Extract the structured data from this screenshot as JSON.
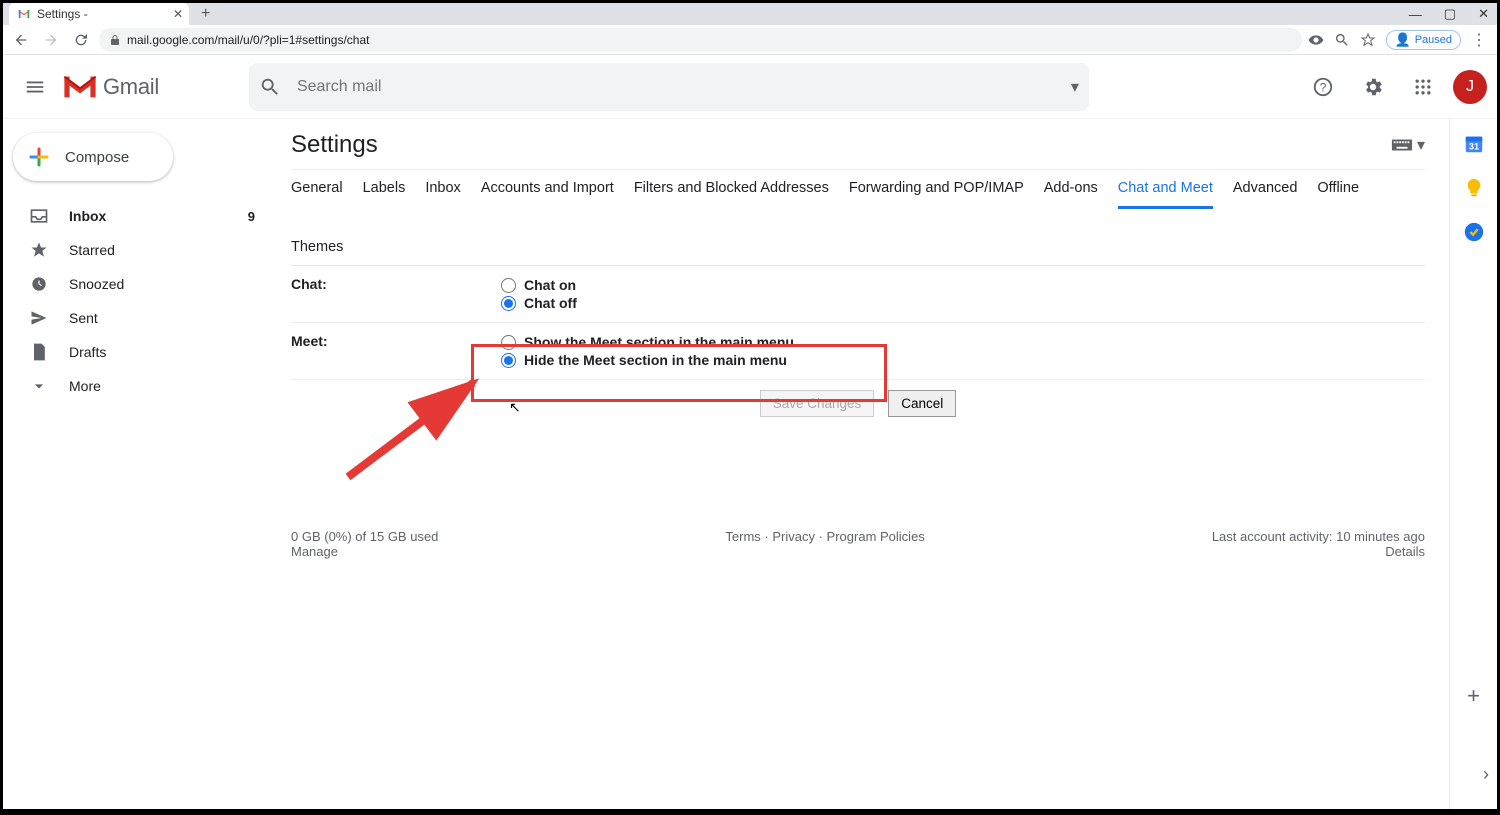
{
  "browser": {
    "tab_title": "Settings -",
    "url": "mail.google.com/mail/u/0/?pli=1#settings/chat",
    "paused_label": "Paused"
  },
  "header": {
    "app_name": "Gmail",
    "search_placeholder": "Search mail",
    "avatar_letter": "J"
  },
  "sidebar": {
    "compose_label": "Compose",
    "items": [
      {
        "label": "Inbox",
        "count": "9",
        "bold": true
      },
      {
        "label": "Starred"
      },
      {
        "label": "Snoozed"
      },
      {
        "label": "Sent"
      },
      {
        "label": "Drafts"
      },
      {
        "label": "More"
      }
    ]
  },
  "settings": {
    "title": "Settings",
    "tabs": [
      "General",
      "Labels",
      "Inbox",
      "Accounts and Import",
      "Filters and Blocked Addresses",
      "Forwarding and POP/IMAP",
      "Add-ons",
      "Chat and Meet",
      "Advanced",
      "Offline",
      "Themes"
    ],
    "active_tab": "Chat and Meet",
    "chat": {
      "label": "Chat:",
      "opt_on": "Chat on",
      "opt_off": "Chat off",
      "selected": "off"
    },
    "meet": {
      "label": "Meet:",
      "opt_show": "Show the Meet section in the main menu",
      "opt_hide": "Hide the Meet section in the main menu",
      "selected": "hide"
    },
    "save_label": "Save Changes",
    "cancel_label": "Cancel"
  },
  "footer": {
    "storage": "0 GB (0%) of 15 GB used",
    "manage": "Manage",
    "terms": "Terms",
    "privacy": "Privacy",
    "policies": "Program Policies",
    "activity": "Last account activity: 10 minutes ago",
    "details": "Details"
  }
}
